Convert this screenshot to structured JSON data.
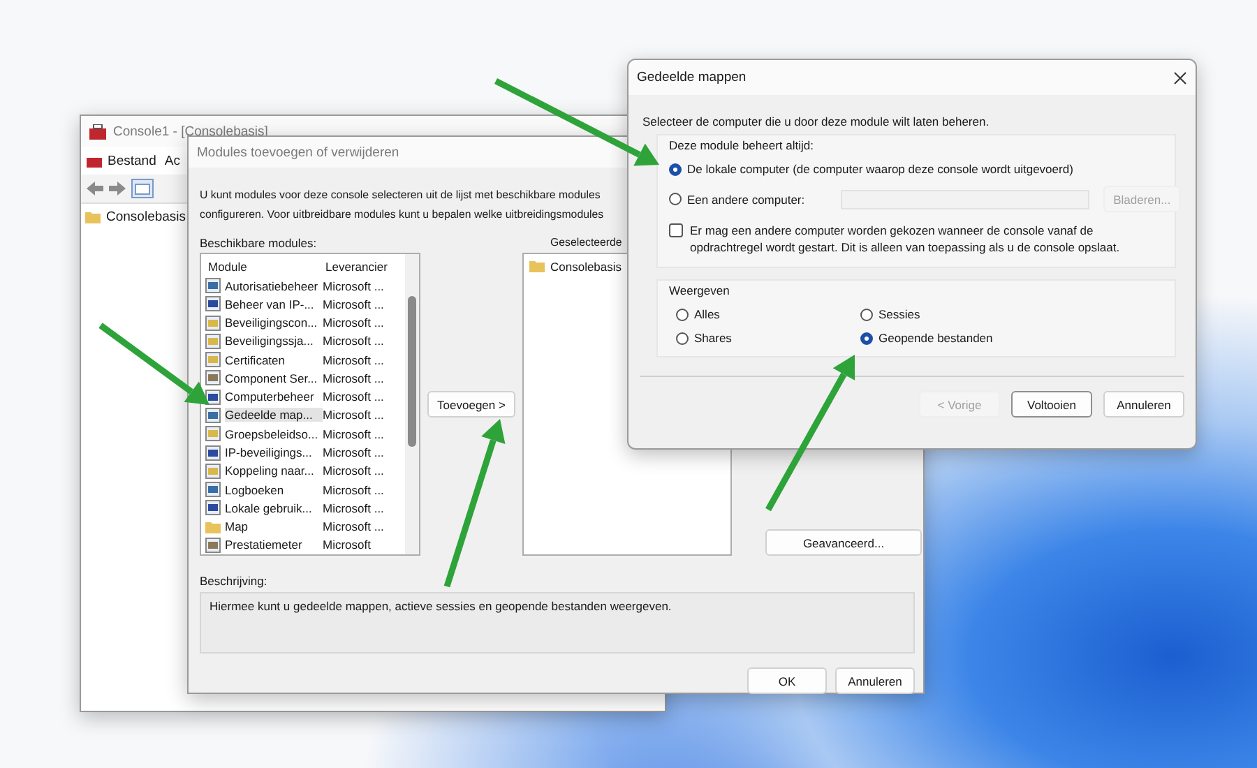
{
  "console_window": {
    "title": "Console1 - [Consolebasis]",
    "menu": [
      "Bestand",
      "Ac"
    ],
    "tree": [
      {
        "label": "Consolebasis"
      }
    ]
  },
  "modules_dialog": {
    "title": "Modules toevoegen of verwijderen",
    "intro": [
      "U kunt modules voor deze console selecteren uit de lijst met beschikbare modules",
      "configureren. Voor uitbreidbare modules kunt u bepalen welke uitbreidingsmodules"
    ],
    "available_label": "Beschikbare modules:",
    "columns": [
      "Module",
      "Leverancier"
    ],
    "modules": [
      {
        "name": "Autorisatiebeheer",
        "vendor": "Microsoft ...",
        "selected": false,
        "kind": "app"
      },
      {
        "name": "Beheer van IP-...",
        "vendor": "Microsoft ...",
        "selected": false,
        "kind": "network"
      },
      {
        "name": "Beveiligingscon...",
        "vendor": "Microsoft ...",
        "selected": false,
        "kind": "document"
      },
      {
        "name": "Beveiligingssja...",
        "vendor": "Microsoft ...",
        "selected": false,
        "kind": "document"
      },
      {
        "name": "Certificaten",
        "vendor": "Microsoft ...",
        "selected": false,
        "kind": "document"
      },
      {
        "name": "Component Ser...",
        "vendor": "Microsoft ...",
        "selected": false,
        "kind": "gear"
      },
      {
        "name": "Computerbeheer",
        "vendor": "Microsoft ...",
        "selected": false,
        "kind": "network"
      },
      {
        "name": "Gedeelde map...",
        "vendor": "Microsoft ...",
        "selected": true,
        "kind": "app"
      },
      {
        "name": "Groepsbeleidso...",
        "vendor": "Microsoft ...",
        "selected": false,
        "kind": "document"
      },
      {
        "name": "IP-beveiligings...",
        "vendor": "Microsoft ...",
        "selected": false,
        "kind": "network"
      },
      {
        "name": "Koppeling naar...",
        "vendor": "Microsoft ...",
        "selected": false,
        "kind": "document"
      },
      {
        "name": "Logboeken",
        "vendor": "Microsoft ...",
        "selected": false,
        "kind": "app"
      },
      {
        "name": "Lokale gebruik...",
        "vendor": "Microsoft ...",
        "selected": false,
        "kind": "network"
      },
      {
        "name": "Map",
        "vendor": "Microsoft ...",
        "selected": false,
        "kind": "folder"
      },
      {
        "name": "Prestatiemeter",
        "vendor": "Microsoft",
        "selected": false,
        "kind": "gear"
      }
    ],
    "add_button": "Toevoegen >",
    "selected_label": "Geselecteerde",
    "selected_modules": [
      "Consolebasis"
    ],
    "advanced_button": "Geavanceerd...",
    "description_label": "Beschrijving:",
    "description": "Hiermee kunt u gedeelde mappen, actieve sessies en geopende bestanden weergeven.",
    "buttons": [
      "OK",
      "Annuleren"
    ]
  },
  "shared_folders_dialog": {
    "title": "Gedeelde mappen",
    "prompt": "Selecteer de computer die u door deze module wilt laten beheren.",
    "manage_group": {
      "label": "Deze module beheert altijd:",
      "options": [
        {
          "label": "De lokale computer (de computer waarop deze console wordt uitgevoerd)",
          "selected": true
        },
        {
          "label": "Een andere computer:",
          "selected": false
        }
      ],
      "browse_button": {
        "label": "Bladeren...",
        "disabled": true
      },
      "checkbox": {
        "label": "Er mag een andere computer worden gekozen wanneer de console vanaf de opdrachtregel wordt gestart. Dit is alleen van toepassing als u de console opslaat.",
        "checked": false
      }
    },
    "view_group": {
      "label": "Weergeven",
      "options": [
        {
          "label": "Alles",
          "selected": false
        },
        {
          "label": "Sessies",
          "selected": false
        },
        {
          "label": "Shares",
          "selected": false
        },
        {
          "label": "Geopende bestanden",
          "selected": true
        }
      ]
    },
    "buttons": [
      {
        "label": "< Vorige",
        "disabled": true,
        "default": false
      },
      {
        "label": "Voltooien",
        "disabled": false,
        "default": true
      },
      {
        "label": "Annuleren",
        "disabled": false,
        "default": false
      }
    ]
  }
}
